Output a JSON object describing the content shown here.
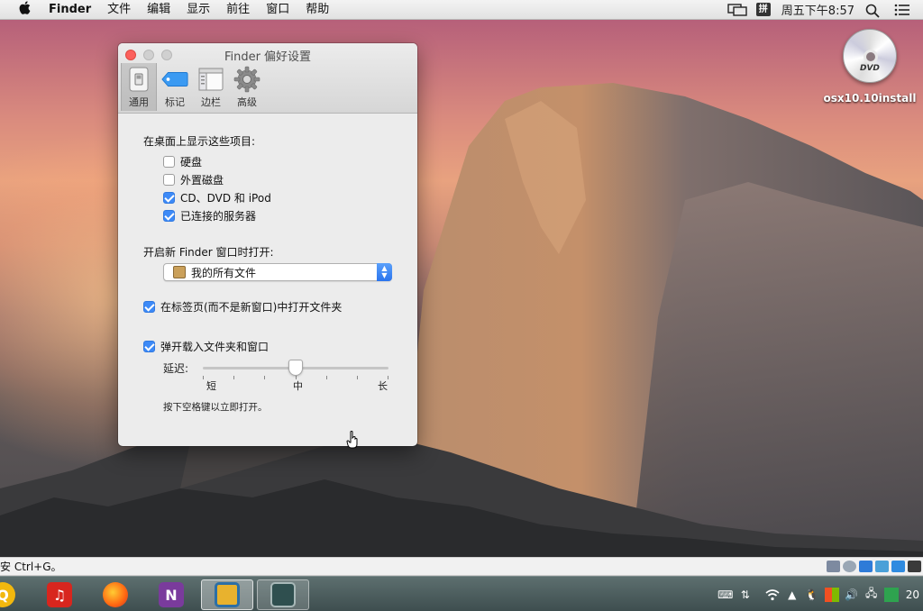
{
  "menubar": {
    "apple_icon": "apple-logo-icon",
    "items": [
      "Finder",
      "文件",
      "编辑",
      "显示",
      "前往",
      "窗口",
      "帮助"
    ],
    "clock": "周五下午8:57",
    "ime_badge": "拼"
  },
  "desktop": {
    "dvd_label": "osx10.10install",
    "dvd_tag": "DVD"
  },
  "window": {
    "title": "Finder 偏好设置",
    "toolbar": [
      "通用",
      "标记",
      "边栏",
      "高级"
    ],
    "desktop_section_label": "在桌面上显示这些项目:",
    "desktop_items": [
      {
        "label": "硬盘",
        "checked": false
      },
      {
        "label": "外置磁盘",
        "checked": false
      },
      {
        "label": "CD、DVD 和 iPod",
        "checked": true
      },
      {
        "label": "已连接的服务器",
        "checked": true
      }
    ],
    "new_window_label": "开启新 Finder 窗口时打开:",
    "new_window_value": "我的所有文件",
    "open_in_tabs": {
      "label": "在标签页(而不是新窗口)中打开文件夹",
      "checked": true
    },
    "spring_loaded": {
      "label": "弹开载入文件夹和窗口",
      "checked": true
    },
    "delay_label": "延迟:",
    "delay_level": 0.5,
    "slider_short": "短",
    "slider_mid": "中",
    "slider_long": "长",
    "hint": "按下空格键以立即打开。"
  },
  "hintbar": {
    "text": "安 Ctrl+G。"
  },
  "taskbar": {
    "apps": [
      "qq-music-icon",
      "netease-music-icon",
      "firefox-icon",
      "onenote-icon",
      "vmware-icon",
      "terminal-icon"
    ],
    "clock_partial": "20"
  },
  "colors": {
    "accent": "#3d8af7",
    "close": "#fc605c"
  }
}
